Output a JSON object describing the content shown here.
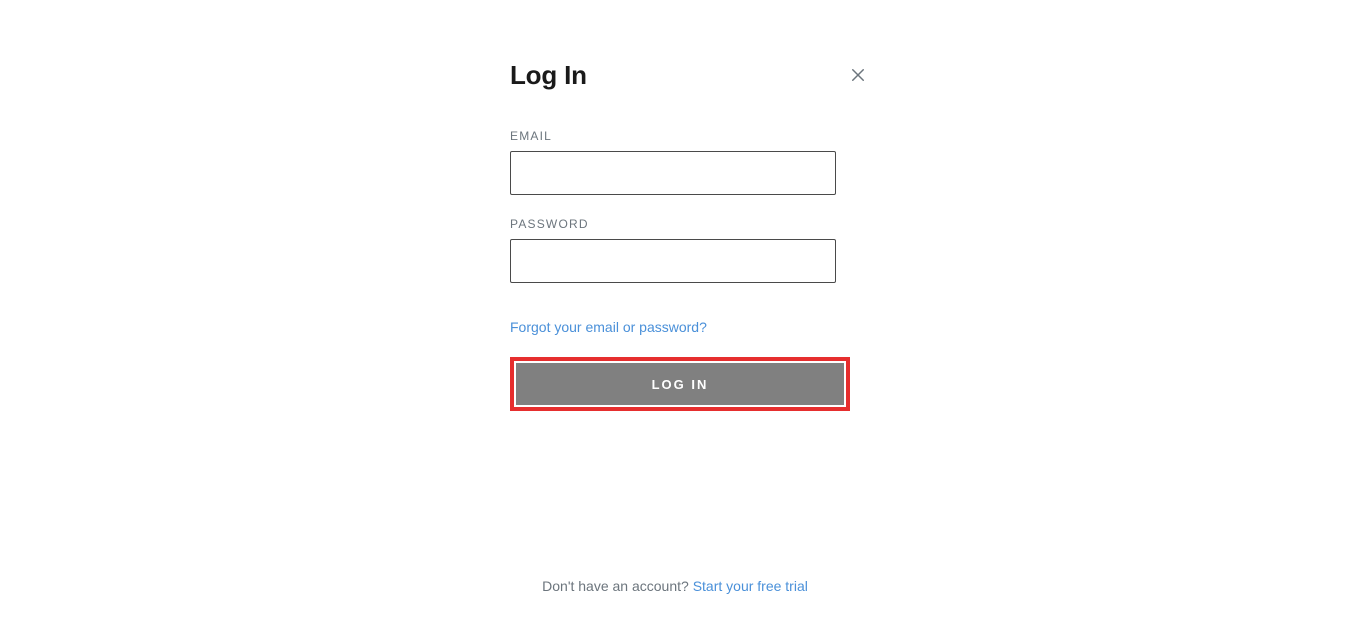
{
  "title": "Log In",
  "fields": {
    "email": {
      "label": "EMAIL",
      "value": ""
    },
    "password": {
      "label": "PASSWORD",
      "value": ""
    }
  },
  "forgot_link": "Forgot your email or password?",
  "login_button": "LOG IN",
  "footer": {
    "prompt": "Don't have an account? ",
    "link": "Start your free trial"
  }
}
